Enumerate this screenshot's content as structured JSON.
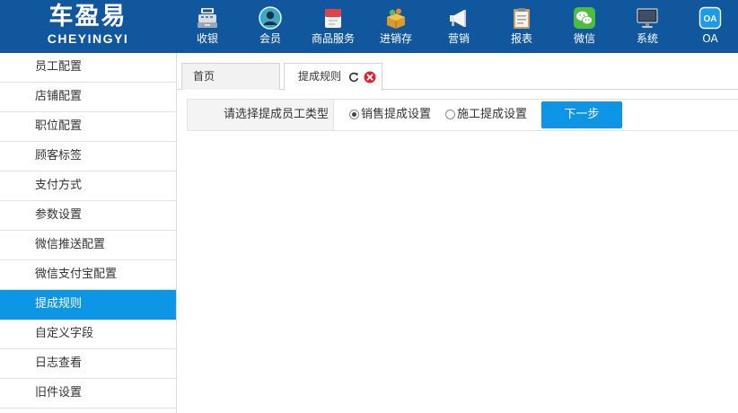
{
  "logo": {
    "title": "车盈易",
    "subtitle": "CHEYINGYI"
  },
  "nav": [
    {
      "label": "收银",
      "icon": "cash-register-icon"
    },
    {
      "label": "会员",
      "icon": "member-user-icon"
    },
    {
      "label": "商品服务",
      "icon": "product-service-icon"
    },
    {
      "label": "进销存",
      "icon": "inventory-box-icon"
    },
    {
      "label": "营销",
      "icon": "megaphone-icon"
    },
    {
      "label": "报表",
      "icon": "report-clipboard-icon"
    },
    {
      "label": "微信",
      "icon": "wechat-icon"
    },
    {
      "label": "系统",
      "icon": "monitor-icon"
    },
    {
      "label": "OA",
      "icon": "oa-icon",
      "icon_text": "OA"
    }
  ],
  "sidebar": {
    "items": [
      {
        "label": "员工配置"
      },
      {
        "label": "店铺配置"
      },
      {
        "label": "职位配置"
      },
      {
        "label": "顾客标签"
      },
      {
        "label": "支付方式"
      },
      {
        "label": "参数设置"
      },
      {
        "label": "微信推送配置"
      },
      {
        "label": "微信支付宝配置"
      },
      {
        "label": "提成规则",
        "active": true
      },
      {
        "label": "自定义字段"
      },
      {
        "label": "日志查看"
      },
      {
        "label": "旧件设置"
      }
    ]
  },
  "tabs": {
    "home": "首页",
    "active": "提成规则",
    "refresh_icon": "refresh-icon",
    "close_icon": "close-icon"
  },
  "form": {
    "label": "请选择提成员工类型",
    "options": [
      {
        "label": "销售提成设置",
        "checked": true
      },
      {
        "label": "施工提成设置",
        "checked": false
      }
    ],
    "next_button": "下一步"
  },
  "colors": {
    "header_bg": "#10579e",
    "accent": "#0e96e6",
    "close_red": "#d9252b"
  }
}
